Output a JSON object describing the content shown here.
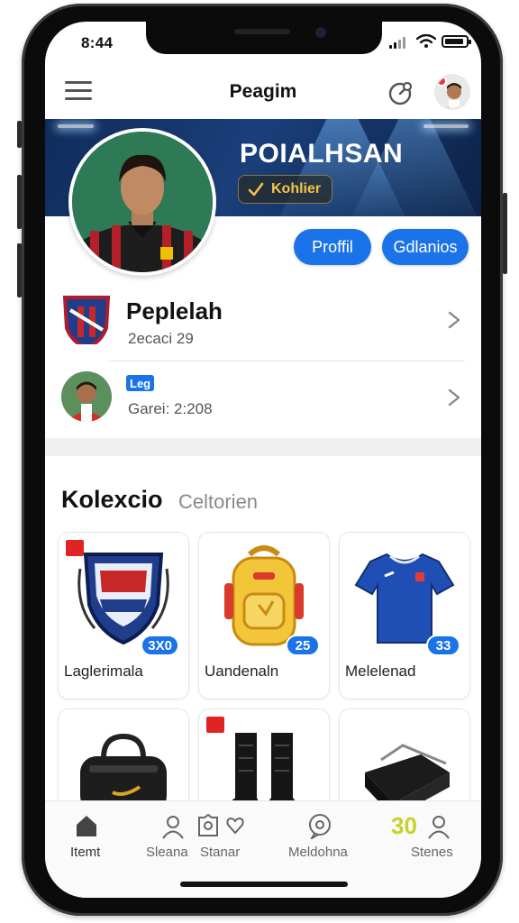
{
  "status_bar": {
    "time": "8:44"
  },
  "header": {
    "title": "Peagim"
  },
  "banner": {
    "title": "POIALHSAN",
    "badge_label": "Kohlier"
  },
  "profile_actions": {
    "profile_label": "Proffil",
    "secondary_label": "Gdlanios"
  },
  "list": {
    "items": [
      {
        "title": "Peplelah",
        "subtitle": "2ecaci 29",
        "tag": ""
      },
      {
        "title": "",
        "subtitle": "Garei: 2:208",
        "tag": "Leg"
      }
    ]
  },
  "collection": {
    "title": "Kolexcio",
    "subtitle": "Celtorien",
    "cards": [
      {
        "label": "Laglerimala",
        "count": "3X0",
        "icon": "club-crest-icon"
      },
      {
        "label": "Uandenaln",
        "count": "25",
        "icon": "backpack-icon"
      },
      {
        "label": "Melelenad",
        "count": "33",
        "icon": "jersey-icon"
      },
      {
        "label": "",
        "count": "",
        "icon": "duffel-bag-icon"
      },
      {
        "label": "",
        "count": "",
        "icon": "boots-icon"
      },
      {
        "label": "",
        "count": "",
        "icon": "shoulder-bag-icon"
      }
    ]
  },
  "tabbar": {
    "items": [
      {
        "label": "Itemt",
        "icon": "home-icon"
      },
      {
        "label": "Sleana",
        "icon": "user-icon"
      },
      {
        "label": "Stanar",
        "icon": "badge-icon"
      },
      {
        "label": "Meldohna",
        "icon": "chat-icon"
      },
      {
        "label": "Stenes",
        "icon": "user-icon",
        "badge": "30"
      }
    ]
  },
  "colors": {
    "accent": "#1a73e8",
    "badge_gold": "#f3c34a",
    "tab_badge": "#c7d12a"
  }
}
